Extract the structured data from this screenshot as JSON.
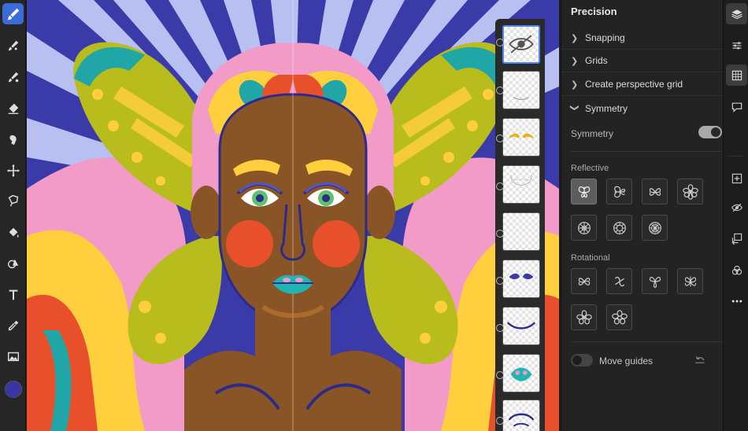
{
  "tools": [
    {
      "name": "paint-brush-tool-icon",
      "active": true
    },
    {
      "name": "pixel-brush-tool-icon"
    },
    {
      "name": "vector-brush-tool-icon"
    },
    {
      "name": "eraser-tool-icon"
    },
    {
      "name": "smudge-tool-icon"
    },
    {
      "name": "transform-tool-icon"
    },
    {
      "name": "lasso-tool-icon"
    },
    {
      "name": "fill-tool-icon"
    },
    {
      "name": "shapes-tool-icon"
    },
    {
      "name": "text-tool-icon"
    },
    {
      "name": "eyedropper-tool-icon"
    },
    {
      "name": "image-tool-icon"
    },
    {
      "name": "color-swatch"
    }
  ],
  "tool_options": {
    "brush_size": "14",
    "brush_color": "#5b4fc4"
  },
  "colors": {
    "accent": "#3a6bd8",
    "current_color": "#3b34a5"
  },
  "panel": {
    "title": "Precision",
    "sections": [
      {
        "label": "Snapping",
        "expanded": false
      },
      {
        "label": "Grids",
        "expanded": false
      },
      {
        "label": "Create perspective grid",
        "expanded": false
      },
      {
        "label": "Symmetry",
        "expanded": true
      }
    ],
    "symmetry_label": "Symmetry",
    "symmetry_on": true,
    "reflective_label": "Reflective",
    "rotational_label": "Rotational",
    "move_guides_label": "Move guides",
    "move_guides_on": false
  },
  "rail_icons": [
    "layers-icon",
    "layer-properties-icon",
    "precision-icon",
    "comments-icon",
    "add-layer-icon",
    "visibility-icon",
    "merge-down-icon",
    "blend-mode-icon",
    "more-icon"
  ]
}
